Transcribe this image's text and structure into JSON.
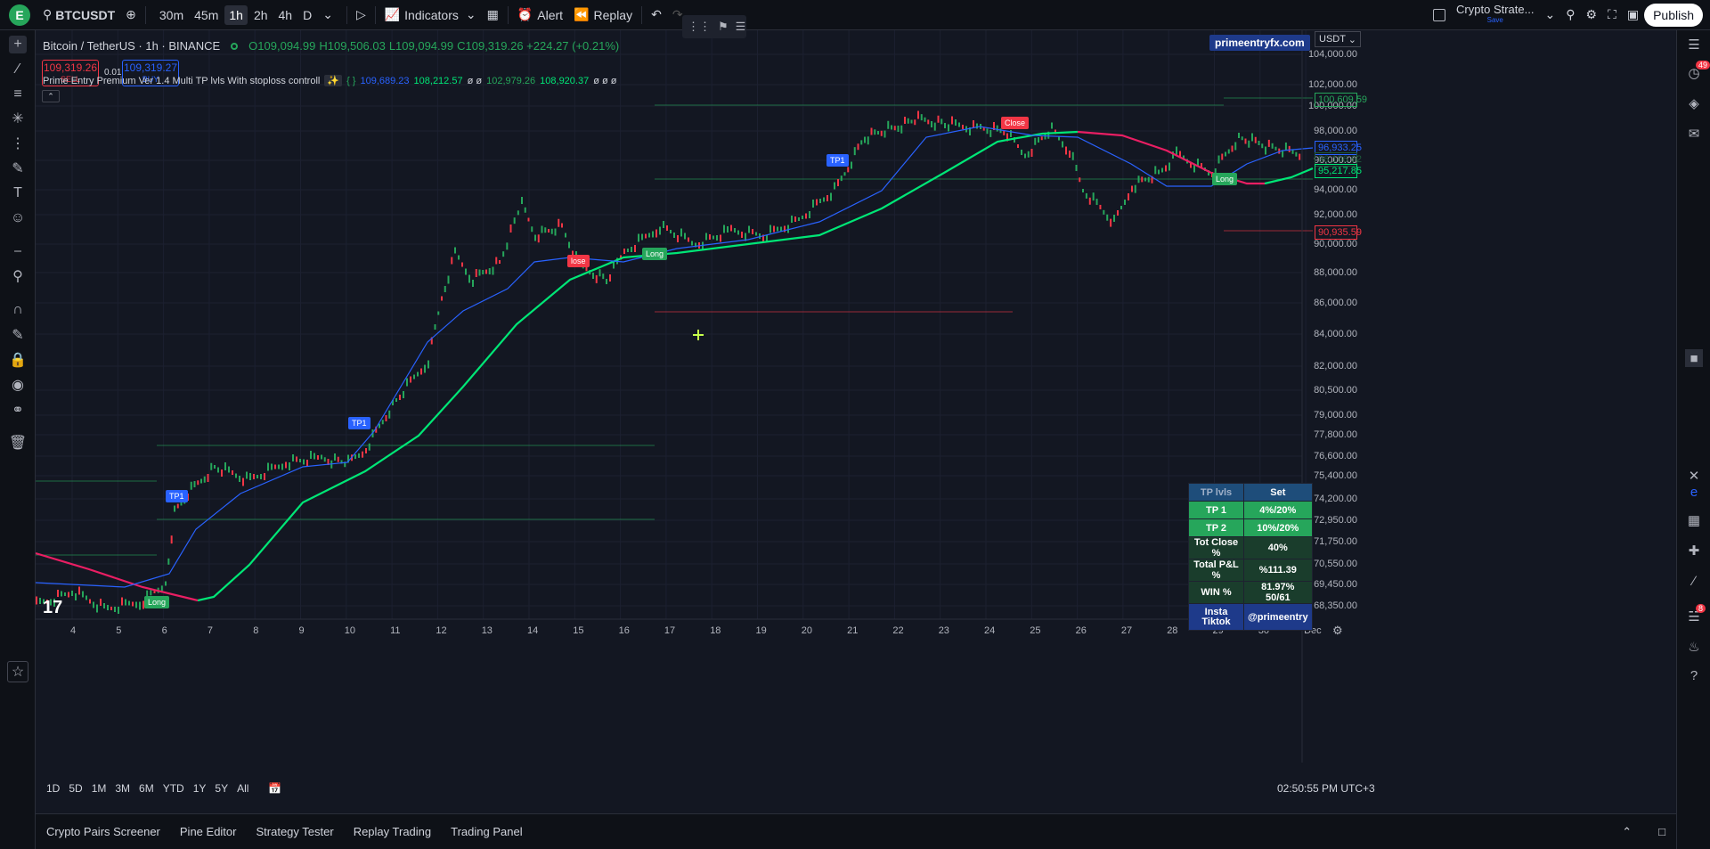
{
  "topbar": {
    "symbol": "BTCUSDT",
    "timeframes": [
      "30m",
      "45m",
      "1h",
      "2h",
      "4h",
      "D"
    ],
    "active_tf": "1h",
    "indicators": "Indicators",
    "alert": "Alert",
    "replay": "Replay",
    "layout_name": "Crypto Strate...",
    "layout_status": "Save",
    "publish": "Publish",
    "logo": "E"
  },
  "legend": {
    "title": "Bitcoin / TetherUS · 1h · BINANCE",
    "o": "O109,094.99",
    "h": "H109,506.03",
    "l": "L109,094.99",
    "c": "C109,319.26 +224.27 (+0.21%)",
    "sell_price": "109,319.26",
    "sell": "SELL",
    "spread": "0.01",
    "buy_price": "109,319.27",
    "buy": "BUY",
    "indicator": "Prime Entry Premium Ver 1.4 Multi TP lvls With stoploss controll",
    "iv1": "109,689.23",
    "iv2": "108,212.57",
    "iv3": "ø ø",
    "iv4": "102,979.26",
    "iv5": "108,920.37",
    "iv6": "ø ø ø"
  },
  "chart": {
    "watermark": "primeentryfx.com",
    "currency": "USDT",
    "y_labels": [
      "104,000.00",
      "102,000.00",
      "100,000.00",
      "98,000.00",
      "96,000.00",
      "94,000.00",
      "92,000.00",
      "90,000.00",
      "88,000.00",
      "86,000.00",
      "84,000.00",
      "82,000.00",
      "80,500.00",
      "79,000.00",
      "77,800.00",
      "76,600.00",
      "75,400.00",
      "74,200.00",
      "72,950.00",
      "71,750.00",
      "70,550.00",
      "69,450.00",
      "68,350.00"
    ],
    "x_labels": [
      "4",
      "5",
      "6",
      "7",
      "8",
      "9",
      "10",
      "11",
      "12",
      "13",
      "14",
      "15",
      "16",
      "17",
      "18",
      "19",
      "20",
      "21",
      "22",
      "23",
      "24",
      "25",
      "26",
      "27",
      "28",
      "29",
      "30",
      "Dec"
    ],
    "price_tags": [
      {
        "v": "100,609.59",
        "c": "#26a65b"
      },
      {
        "v": "96,933.25",
        "c": "#2962ff"
      },
      {
        "v": "96,106.62",
        "c": "#1e5a3c"
      },
      {
        "v": "95,217.85",
        "c": "#00e676"
      },
      {
        "v": "90,935.59",
        "c": "#f23645"
      }
    ],
    "signals": {
      "long": "Long",
      "close": "Close",
      "tp1": "TP1",
      "lose": "lose"
    }
  },
  "tp_table": {
    "header": [
      "TP lvls",
      "Set"
    ],
    "rows": [
      [
        "TP 1",
        "4%/20%"
      ],
      [
        "TP 2",
        "10%/20%"
      ],
      [
        "Tot Close %",
        "40%"
      ],
      [
        "Total P&L %",
        "%111.39"
      ],
      [
        "WIN %",
        "81.97% 50/61"
      ]
    ],
    "social_label_1": "Insta",
    "social_label_2": "Tiktok",
    "handle": "@primeentry"
  },
  "bottom": {
    "ranges": [
      "1D",
      "5D",
      "1M",
      "3M",
      "6M",
      "YTD",
      "1Y",
      "5Y",
      "All"
    ],
    "time": "02:50:55 PM UTC+3",
    "panels": [
      "Crypto Pairs Screener",
      "Pine Editor",
      "Strategy Tester",
      "Replay Trading",
      "Trading Panel"
    ]
  },
  "right_badges": {
    "alerts": "49",
    "notifications": "8"
  }
}
